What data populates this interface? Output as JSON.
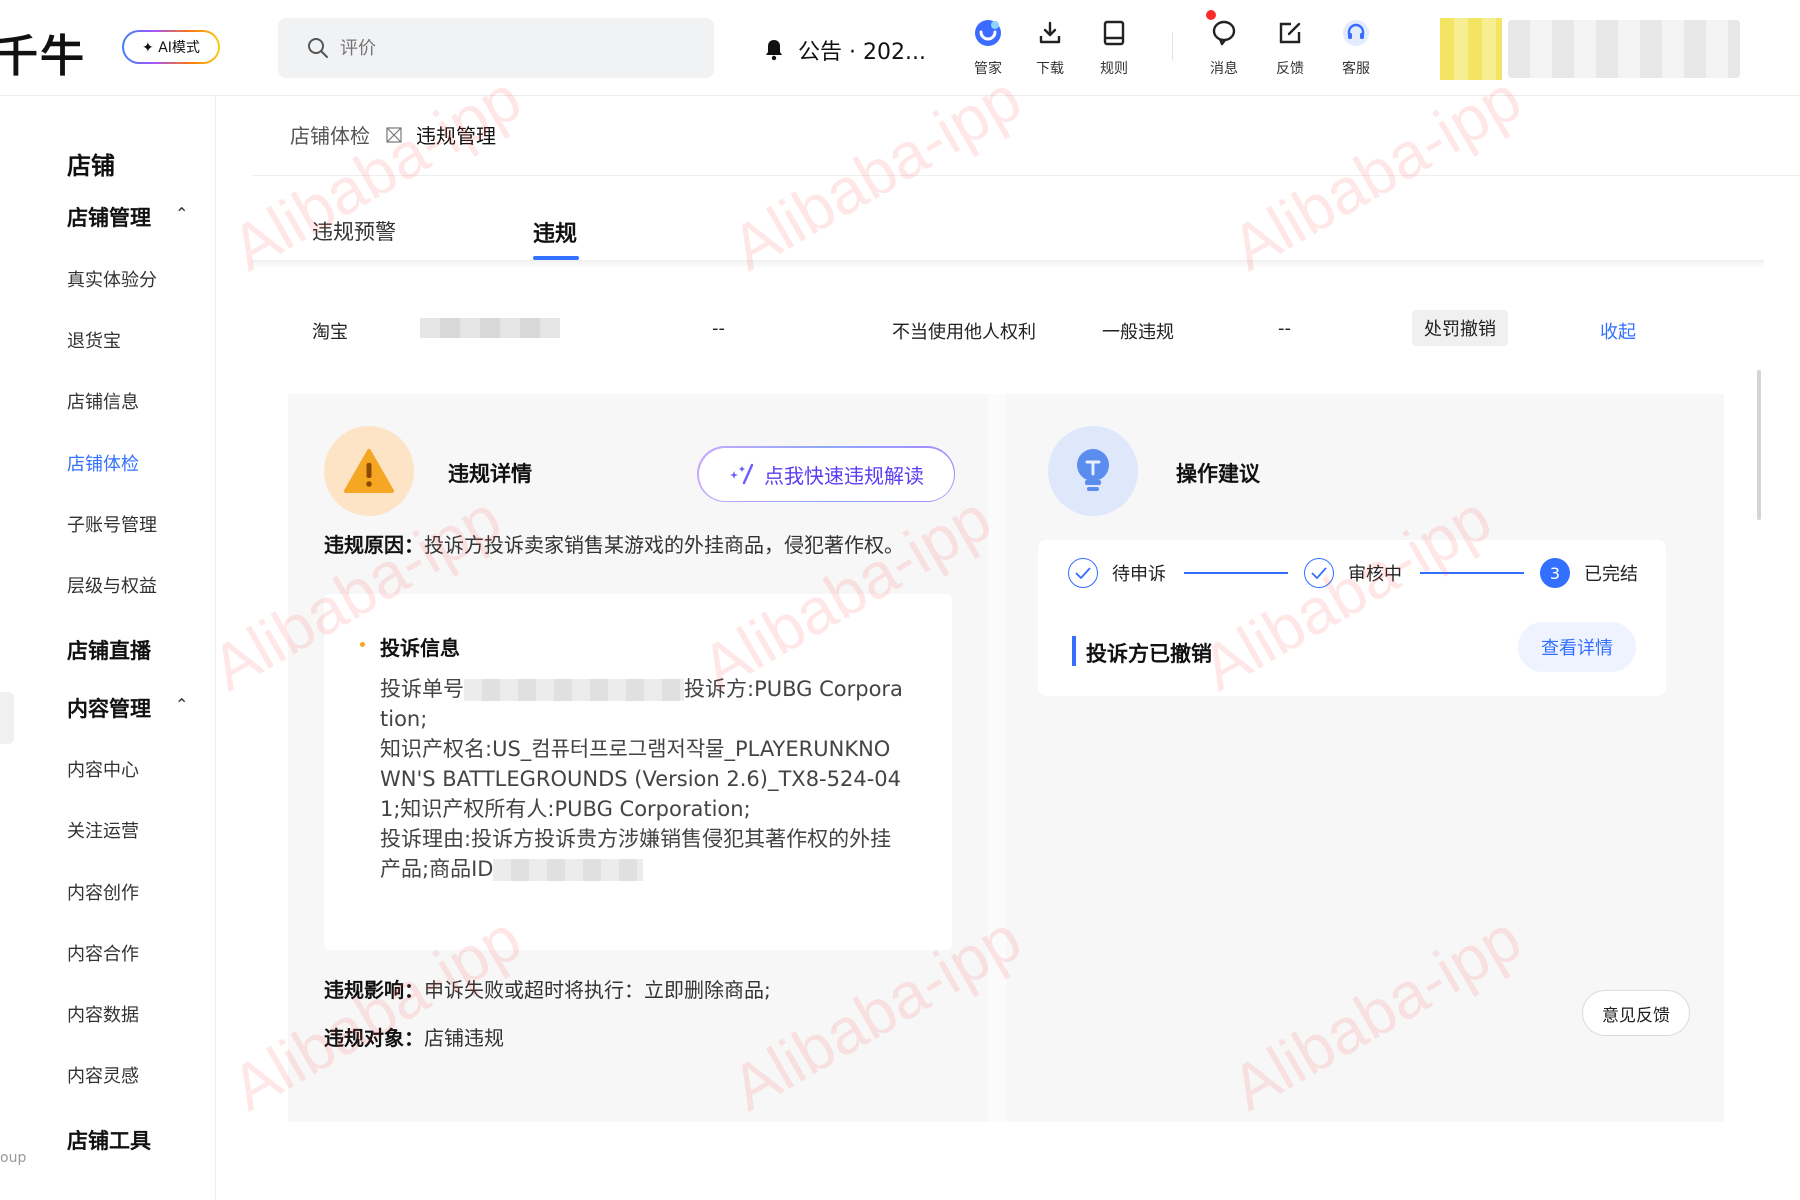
{
  "topbar": {
    "logo": "千牛",
    "ai_mode_label": "✦ AI模式",
    "search_placeholder": "评价",
    "notice": "公告 · 202...",
    "tools": [
      {
        "label": "管家",
        "icon": "assistant-icon"
      },
      {
        "label": "下载",
        "icon": "download-icon"
      },
      {
        "label": "规则",
        "icon": "book-icon"
      },
      {
        "label": "消息",
        "icon": "message-icon"
      },
      {
        "label": "反馈",
        "icon": "feedback-icon"
      },
      {
        "label": "客服",
        "icon": "headset-icon"
      }
    ]
  },
  "sidebar": {
    "head": "店铺",
    "groups": [
      {
        "label": "店铺管理",
        "items": [
          "真实体验分",
          "退货宝",
          "店铺信息",
          "店铺体检",
          "子账号管理",
          "层级与权益"
        ]
      },
      {
        "label": "店铺直播",
        "items": []
      },
      {
        "label": "内容管理",
        "items": [
          "内容中心",
          "关注运营",
          "内容创作",
          "内容合作",
          "内容数据",
          "内容灵感"
        ]
      },
      {
        "label": "店铺工具",
        "items": []
      }
    ],
    "active_item": "店铺体检",
    "edge_text": "oup"
  },
  "breadcrumb": {
    "parent": "店铺体检",
    "current": "违规管理"
  },
  "tabs": [
    "违规预警",
    "违规"
  ],
  "active_tab": "违规",
  "record_row": {
    "platform": "淘宝",
    "col_dash_1": "--",
    "type": "不当使用他人权利",
    "level": "一般违规",
    "col_dash_2": "--",
    "status": "处罚撤销",
    "collapse": "收起"
  },
  "violation_detail": {
    "title": "违规详情",
    "ai_button": "点我快速违规解读",
    "reason_label": "违规原因：",
    "reason": "投诉方投诉卖家销售某游戏的外挂商品，侵犯著作权。",
    "complaint": {
      "title": "投诉信息",
      "order_label": "投诉单号",
      "body_1": "投诉方:PUBG Corporation;",
      "body_2": "知识产权名:US_컴퓨터프로그램저작물_PLAYERUNKNOWN'S BATTLEGROUNDS (Version 2.6)_TX8-524-041;知识产权所有人:PUBG Corporation;",
      "body_3": "投诉理由:投诉方投诉贵方涉嫌销售侵犯其著作权的外挂产品;商品ID"
    },
    "impact_label": "违规影响：",
    "impact": "申诉失败或超时将执行：立即删除商品;",
    "target_label": "违规对象：",
    "target": "店铺违规"
  },
  "operation": {
    "title": "操作建议",
    "steps": [
      {
        "label": "待申诉",
        "state": "done"
      },
      {
        "label": "审核中",
        "state": "done"
      },
      {
        "label": "已完结",
        "state": "current",
        "number": "3"
      }
    ],
    "result": "投诉方已撤销",
    "view_detail": "查看详情"
  },
  "feedback_button": "意见反馈",
  "watermark": "Alibaba-ipp",
  "colors": {
    "accent": "#3370ff",
    "warning": "#f5a623",
    "ai_purple": "#5b3cf5"
  }
}
